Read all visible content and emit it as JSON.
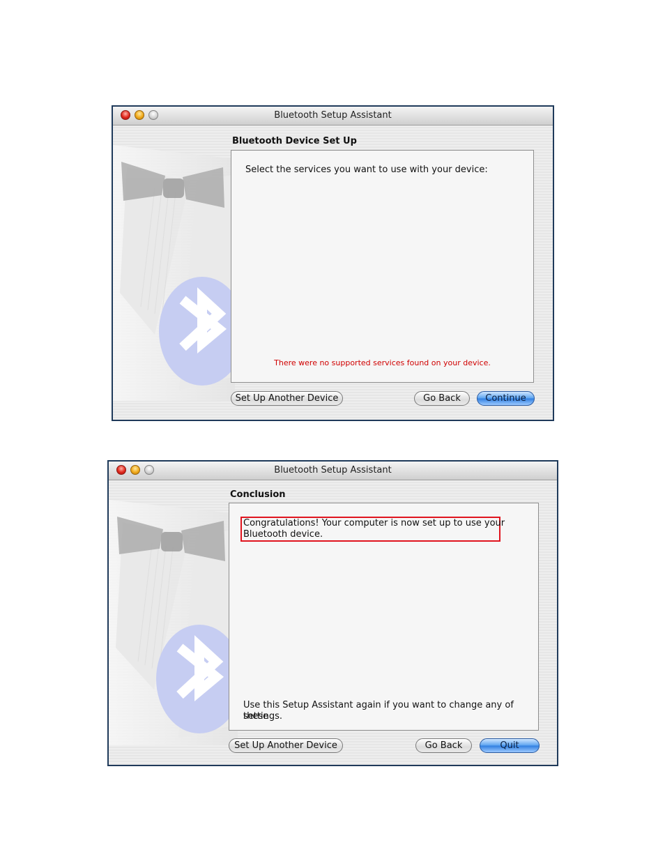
{
  "window1": {
    "title": "Bluetooth Setup Assistant",
    "section_title": "Bluetooth Device Set Up",
    "prompt": "Select the services you want to use with your device:",
    "error_message": "There were no supported services found on your device.",
    "buttons": {
      "setup_another": "Set Up Another Device",
      "go_back": "Go Back",
      "continue": "Continue"
    }
  },
  "window2": {
    "title": "Bluetooth Setup Assistant",
    "section_title": "Conclusion",
    "message_line1": "Congratulations! Your computer is now set up to use your",
    "message_line2": "Bluetooth device.",
    "footer_line1": "Use this Setup Assistant again if you want to change any of these",
    "footer_line2": "settings.",
    "buttons": {
      "setup_another": "Set Up Another Device",
      "go_back": "Go Back",
      "quit": "Quit"
    }
  },
  "colors": {
    "error": "#d00000",
    "highlight_border": "#e0141e",
    "primary_button": "#2f7ee0",
    "window_border": "#1f3a5a"
  }
}
